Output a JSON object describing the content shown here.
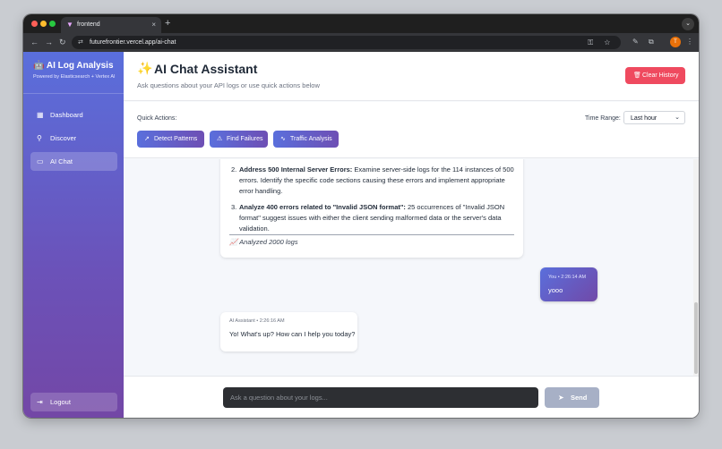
{
  "browser": {
    "tab_title": "frontend",
    "tab_close": "×",
    "new_tab": "+",
    "tab_menu": "⌄",
    "back": "←",
    "forward": "→",
    "reload": "↻",
    "site_icon": "⇄",
    "url": "futurefrontier.vercel.app/ai-chat",
    "omni_icons": "⚿ ☆",
    "profile_initial": "T"
  },
  "sidebar": {
    "brand_title": "AI Log Analysis",
    "brand_icon": "🤖",
    "brand_subtitle": "Powered by Elasticsearch + Vertex AI",
    "items": [
      {
        "label": "Dashboard",
        "icon": "▦"
      },
      {
        "label": "Discover",
        "icon": "⚲"
      },
      {
        "label": "AI Chat",
        "icon": "▭"
      }
    ],
    "logout_label": "Logout",
    "logout_icon": "⇥"
  },
  "header": {
    "icon": "✨",
    "title": "AI Chat Assistant",
    "subtitle": "Ask questions about your API logs or use quick actions below",
    "clear_label": "Clear History",
    "clear_icon": "🗑"
  },
  "quick_actions": {
    "label": "Quick Actions:",
    "buttons": [
      {
        "label": "Detect Patterns",
        "icon": "↗"
      },
      {
        "label": "Find Failures",
        "icon": "⚠"
      },
      {
        "label": "Traffic Analysis",
        "icon": "∿"
      }
    ],
    "time_range_label": "Time Range:",
    "time_range_value": "Last hour",
    "time_range_chevron": "⌄"
  },
  "messages": {
    "ai_analysis": {
      "items": [
        {
          "number": "2.",
          "title": "Address 500 Internal Server Errors:",
          "body": " Examine server-side logs for the 114 instances of 500 errors. Identify the specific code sections causing these errors and implement appropriate error handling."
        },
        {
          "number": "3.",
          "title": "Analyze 400 errors related to \"Invalid JSON format\":",
          "body": " 25 occurrences of \"Invalid JSON format\" suggest issues with either the client sending malformed data or the server's data validation."
        }
      ],
      "footer": "📈 Analyzed 2000 logs"
    },
    "user": {
      "meta": "You • 2:26:14 AM",
      "text": "yooo"
    },
    "ai_reply": {
      "meta": "AI Assistant • 2:26:16 AM",
      "text": "Yo! What's up? How can I help you today?"
    }
  },
  "input": {
    "placeholder": "Ask a question about your logs...",
    "value": "",
    "send_label": "Send",
    "send_icon": "➤"
  },
  "colors": {
    "sidebar_top": "#5a6fdc",
    "sidebar_bottom": "#7347a6",
    "danger": "#ef4a5f",
    "send_disabled": "#a7b0c6"
  }
}
